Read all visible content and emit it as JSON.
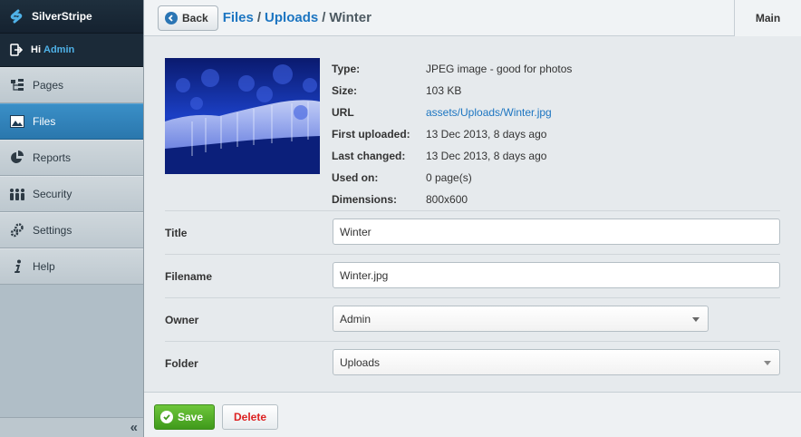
{
  "brand": {
    "name": "SilverStripe"
  },
  "user": {
    "greeting": "Hi",
    "name": "Admin"
  },
  "sidebar": {
    "items": [
      {
        "label": "Pages",
        "icon": "sitetree-icon"
      },
      {
        "label": "Files",
        "icon": "image-icon",
        "active": true
      },
      {
        "label": "Reports",
        "icon": "pie-chart-icon"
      },
      {
        "label": "Security",
        "icon": "users-icon"
      },
      {
        "label": "Settings",
        "icon": "gears-icon"
      },
      {
        "label": "Help",
        "icon": "info-icon"
      }
    ],
    "collapse_label": "«"
  },
  "header": {
    "back_label": "Back",
    "breadcrumbs": [
      "Files",
      "Uploads",
      "Winter"
    ],
    "separator": "/",
    "tab_main": "Main"
  },
  "file_info": [
    {
      "label": "Type:",
      "value": "JPEG image - good for photos"
    },
    {
      "label": "Size:",
      "value": "103 KB"
    },
    {
      "label": "URL",
      "value": "assets/Uploads/Winter.jpg",
      "link": true
    },
    {
      "label": "First uploaded:",
      "value": "13 Dec 2013, 8 days ago"
    },
    {
      "label": "Last changed:",
      "value": "13 Dec 2013, 8 days ago"
    },
    {
      "label": "Used on:",
      "value": "0 page(s)"
    },
    {
      "label": "Dimensions:",
      "value": "800x600"
    }
  ],
  "form": {
    "title": {
      "label": "Title",
      "value": "Winter"
    },
    "filename": {
      "label": "Filename",
      "value": "Winter.jpg"
    },
    "owner": {
      "label": "Owner",
      "value": "Admin"
    },
    "folder": {
      "label": "Folder",
      "value": "Uploads"
    }
  },
  "actions": {
    "save_label": "Save",
    "delete_label": "Delete"
  },
  "colors": {
    "accent": "#2a80bb",
    "save": "#4fa824",
    "delete": "#dd2222",
    "link": "#1c75c1"
  }
}
